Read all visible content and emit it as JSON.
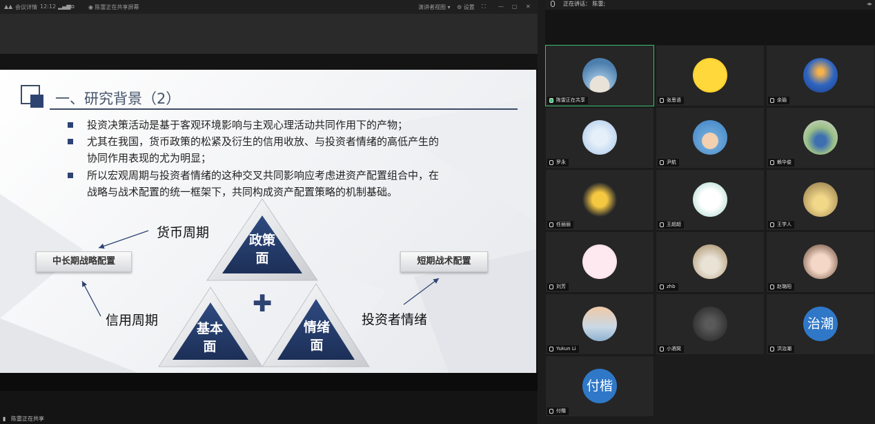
{
  "topbar": {
    "app_name": "会议详情",
    "time": "12:12",
    "sharing_label": "陈雷正在共享屏幕",
    "presenter_view": "演讲者视图",
    "settings": "设置"
  },
  "slide": {
    "title": "一、研究背景（2）",
    "bullets": [
      "投资决策活动是基于客观环境影响与主观心理活动共同作用下的产物；",
      "尤其在我国，货币政策的松紧及衍生的信用收放、与投资者情绪的高低产生的",
      "协同作用表现的尤为明显；",
      "所以宏观周期与投资者情绪的这种交叉共同影响应考虑进资产配置组合中，在",
      "战略与战术配置的统一框架下，共同构成资产配置策略的机制基础。"
    ],
    "triangles": {
      "top": [
        "政策",
        "面"
      ],
      "left": [
        "基本",
        "面"
      ],
      "right": [
        "情绪",
        "面"
      ]
    },
    "plus": "✚",
    "labels": {
      "monetary_cycle": "货币周期",
      "credit_cycle": "信用周期",
      "investor_sentiment": "投资者情绪"
    },
    "chips": {
      "long_term": "中长期战略配置",
      "short_term": "短期战术配置"
    }
  },
  "bottom_status": "陈雷正在共享",
  "speaking": {
    "prefix": "正在讲话：",
    "name": "陈雷;"
  },
  "participants": [
    {
      "name": "陈雷正在共享",
      "avatar": "beach-photo"
    },
    {
      "name": "张思语",
      "avatar": "smiley-emoji"
    },
    {
      "name": "余瑜",
      "avatar": "sunset-photo"
    },
    {
      "name": "罗永",
      "avatar": "sky-photo"
    },
    {
      "name": "尹航",
      "avatar": "cartoon-boy"
    },
    {
      "name": "赖华俊",
      "avatar": "outdoor-photo"
    },
    {
      "name": "任丽丽",
      "avatar": "pikachu"
    },
    {
      "name": "王超超",
      "avatar": "figure-drawing"
    },
    {
      "name": "王学人",
      "avatar": "toy-photo"
    },
    {
      "name": "刘芳",
      "avatar": "bunny-logo"
    },
    {
      "name": "zhb",
      "avatar": "cat-photo"
    },
    {
      "name": "赵璐阳",
      "avatar": "child-photo"
    },
    {
      "name": "Yukun Li",
      "avatar": "sea-photo"
    },
    {
      "name": "小酒窝",
      "avatar": "drums-photo"
    },
    {
      "name": "洪治潮",
      "avatar_text": "治潮"
    },
    {
      "name": "付楷",
      "avatar_text": "付楷"
    }
  ]
}
